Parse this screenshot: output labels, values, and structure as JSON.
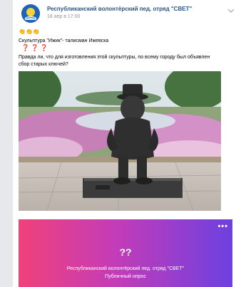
{
  "post": {
    "group_name": "Республиканский волонтёрский пед. отряд \"СВЕТ\"",
    "date": "18 апр в 17:00",
    "emoji": "👏👏👏",
    "title_line": "Скульптура \"Ижик\"- талисман Ижевска",
    "question_marks": "❓❓❓",
    "text_line1": "Правда ли, что для изготовления этой скульптуры, по всему городу был объявлен",
    "text_line2": "сбор старых ключей?"
  },
  "poll": {
    "title": "??",
    "author": "Республиканский волонтёрский пед. отряд \"СВЕТ\"",
    "type": "Публичный опрос"
  },
  "colors": {
    "link": "#2a5885",
    "poll_gradient_start": "#f0417a",
    "poll_gradient_end": "#6d40e0"
  }
}
